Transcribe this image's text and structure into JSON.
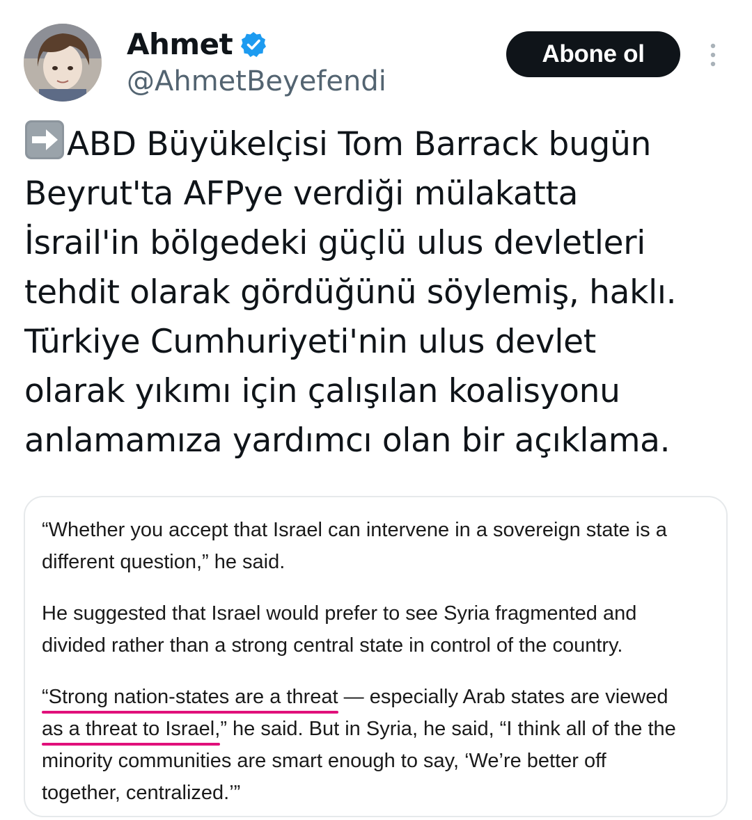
{
  "user": {
    "display_name": "Ahmet",
    "handle": "@AhmetBeyefendi",
    "verified": true,
    "verified_color": "#1d9bf0"
  },
  "actions": {
    "follow_label": "Abone ol"
  },
  "tweet": {
    "lines": [
      "ABD Büyükelçisi Tom Barrack bugün",
      "Beyrut'ta AFPye verdiği mülakatta",
      "İsrail'in bölgedeki güçlü ulus devletleri",
      "tehdit olarak gördüğünü söylemiş, haklı.",
      "Türkiye Cumhuriyeti'nin ulus devlet",
      "olarak yıkımı için çalışılan koalisyonu",
      "anlamamıza yardımcı olan bir açıklama."
    ],
    "leading_icon": "right-arrow-emoji"
  },
  "quote_image": {
    "paragraph1": [
      "“Whether you accept that Israel can intervene in a sovereign state is a",
      "different question,” he said."
    ],
    "paragraph2": [
      "He suggested that Israel would prefer to see Syria fragmented and",
      "divided rather than a strong central state in control of the country."
    ],
    "paragraph3": {
      "line1_highlight": "“Strong nation-states are a threat",
      "line1_rest": " — especially Arab states are viewed",
      "line2_highlight": "as a threat to Israel,",
      "line2_rest": "” he said. But in Syria, he said, “I think all of the the",
      "line3": "minority communities are smart enough to say, ‘We’re better off",
      "line4": "together, centralized.’”"
    },
    "highlight_color": "#e0107a"
  }
}
